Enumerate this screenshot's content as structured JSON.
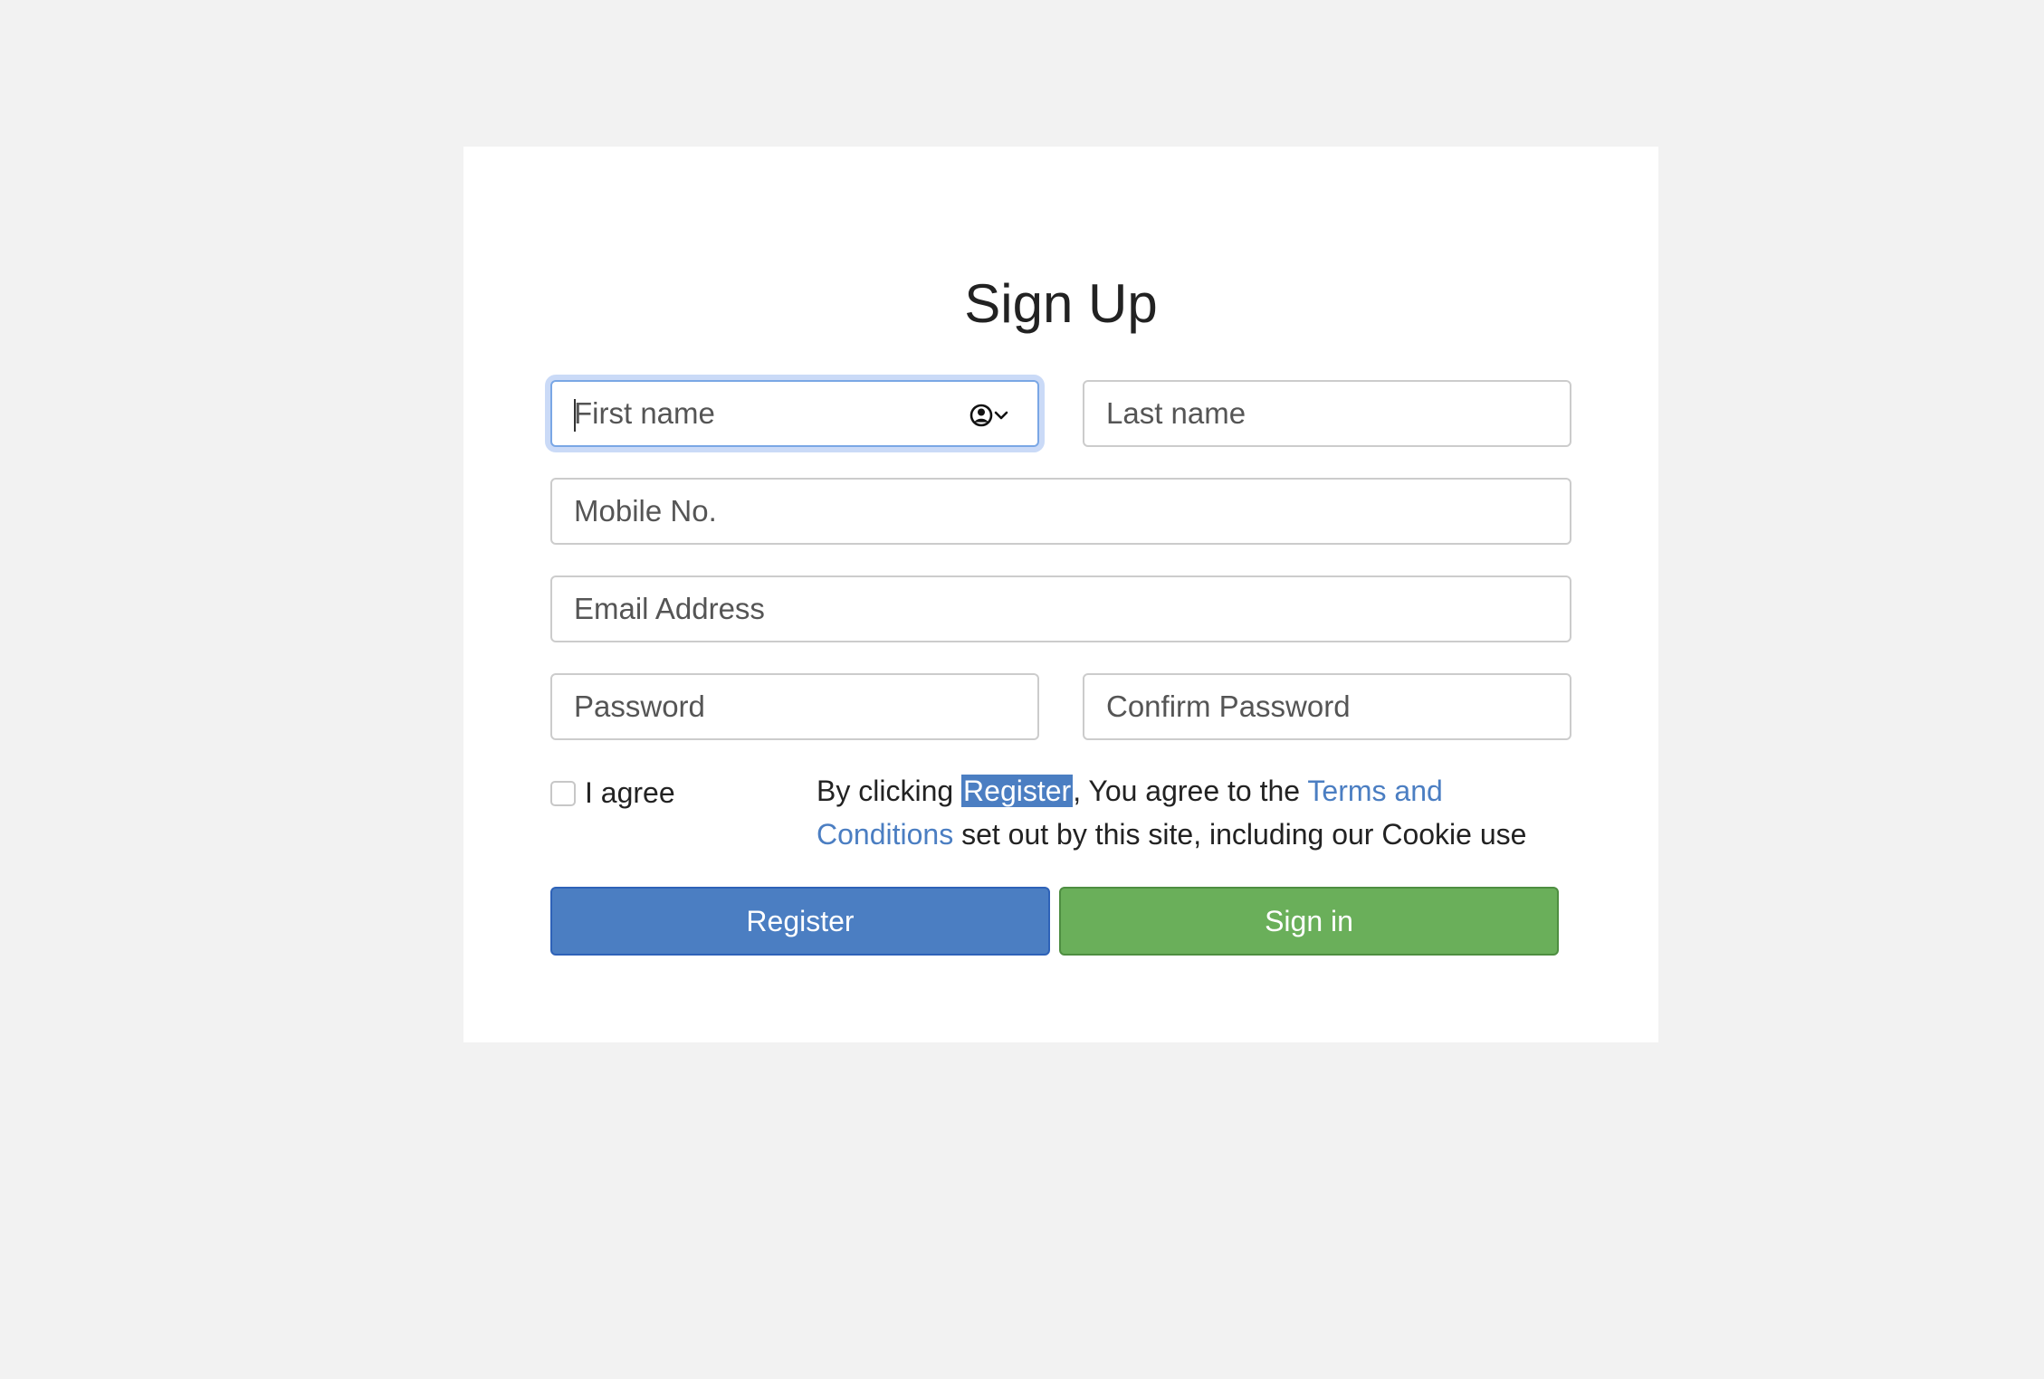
{
  "form": {
    "title": "Sign Up",
    "first_name": {
      "value": "",
      "placeholder": "First name"
    },
    "last_name": {
      "value": "",
      "placeholder": "Last name"
    },
    "mobile": {
      "value": "",
      "placeholder": "Mobile No."
    },
    "email": {
      "value": "",
      "placeholder": "Email Address"
    },
    "password": {
      "value": "",
      "placeholder": "Password"
    },
    "confirm_password": {
      "value": "",
      "placeholder": "Confirm Password"
    },
    "agree_label": "I agree",
    "agree_checked": false,
    "terms": {
      "prefix": "By clicking ",
      "highlight": "Register",
      "middle": ", You agree to the ",
      "link": "Terms and Conditions",
      "suffix": " set out by this site, including our Cookie use"
    },
    "register_label": "Register",
    "signin_label": "Sign in"
  },
  "colors": {
    "primary": "#4b7ec2",
    "success": "#6aaf5a",
    "page_bg": "#f2f2f2"
  }
}
